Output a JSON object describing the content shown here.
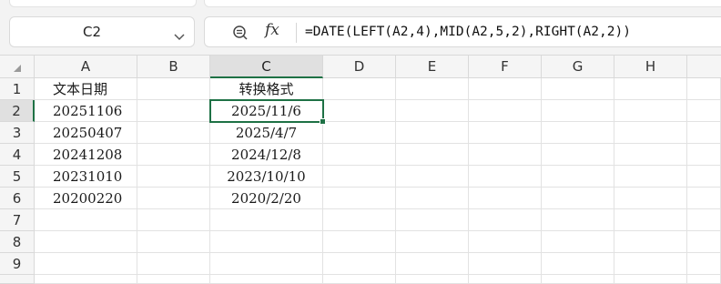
{
  "name_box": {
    "cell_ref": "C2"
  },
  "formula_bar": {
    "fx_label": "fx",
    "formula": "=DATE(LEFT(A2,4),MID(A2,5,2),RIGHT(A2,2))"
  },
  "grid": {
    "columns": [
      "A",
      "B",
      "C",
      "D",
      "E",
      "F",
      "G",
      "H"
    ],
    "active_column": "C",
    "rows": [
      "1",
      "2",
      "3",
      "4",
      "5",
      "6",
      "7",
      "8",
      "9"
    ],
    "active_row": "2",
    "cells": {
      "A1": "文本日期",
      "C1": "转换格式",
      "A2": "20251106",
      "C2": "2025/11/6",
      "A3": "20250407",
      "C3": "2025/4/7",
      "A4": "20241208",
      "C4": "2024/12/8",
      "A5": "20231010",
      "C5": "2023/10/10",
      "A6": "20200220",
      "C6": "2020/2/20"
    }
  }
}
